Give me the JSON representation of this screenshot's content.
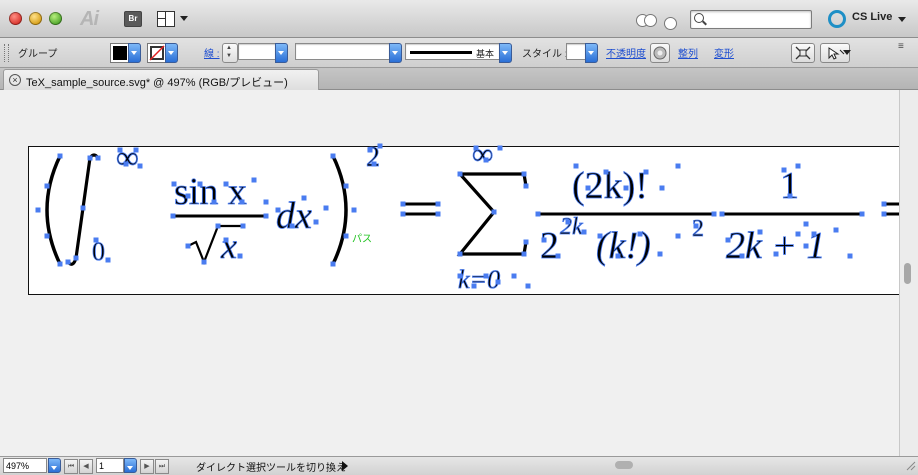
{
  "app": {
    "logo_text": "Ai",
    "bridge_label": "Br",
    "search": {
      "value": "",
      "placeholder": ""
    },
    "cs_live_label": "CS Live"
  },
  "control_bar": {
    "selection_label": "グループ",
    "stroke_label": "線 :",
    "stroke_style_label": "基本",
    "style_label": "スタイル :",
    "opacity_link": "不透明度",
    "align_link": "整列",
    "transform_link": "変形"
  },
  "tab": {
    "title": "TeX_sample_source.svg* @ 497% (RGB/プレビュー)"
  },
  "canvas": {
    "hover_hint": "パス",
    "formula": {
      "lower_limit": "0",
      "upper_limit": "∞",
      "numerator": "sin x",
      "sqrt_arg": "x",
      "differential": "dx",
      "exponent": "2",
      "equals": "=",
      "sum_upper": "∞",
      "sum_lower": "k=0",
      "frac1_num": "(2k)!",
      "frac1_den_base": "2",
      "frac1_den_exp": "2k",
      "frac1_den_rest": "(k!)",
      "frac1_den_exp2": "2",
      "frac2_num": "1",
      "frac2_den": "2k + 1"
    }
  },
  "status_bar": {
    "zoom": "497%",
    "page": "1",
    "message": "ダイレクト選択ツールを切り換え"
  },
  "colors": {
    "anchor_blue": "#4a7cf0",
    "hint_green": "#22c322",
    "cs_live_ring": "#1e8fc6",
    "link_blue": "#1f4fd0"
  }
}
